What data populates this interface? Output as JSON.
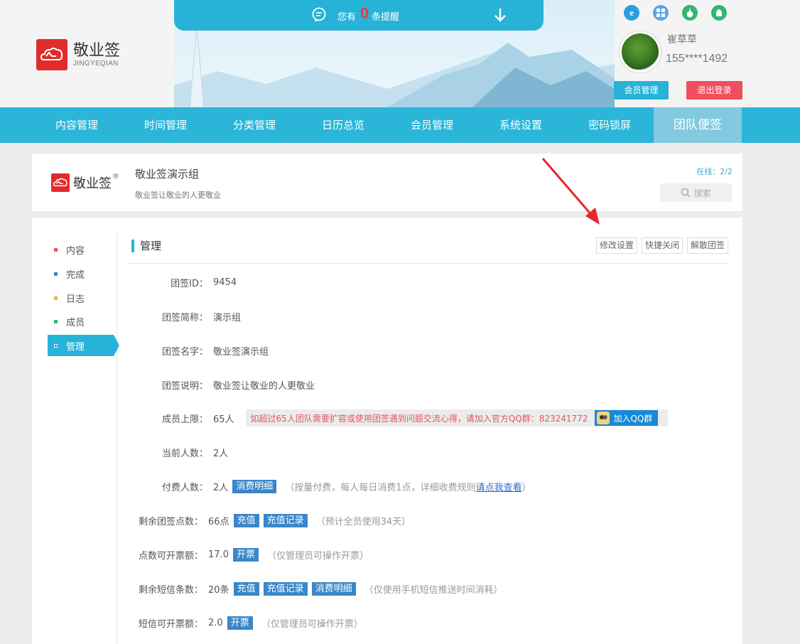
{
  "notice": {
    "prefix": "您有",
    "count": "0",
    "suffix": "条提醒"
  },
  "brand": {
    "name_cn": "敬业签",
    "name_en": "JINGYEQIAN"
  },
  "user": {
    "name": "崔草草",
    "phone": "155****1492",
    "member_label": "会员管理",
    "logout_label": "退出登录"
  },
  "os_icons": [
    "ie-icon",
    "windows-icon",
    "apple-icon",
    "android-icon"
  ],
  "nav": [
    "内容管理",
    "时间管理",
    "分类管理",
    "日历总览",
    "会员管理",
    "系统设置",
    "密码锁屏",
    "团队便签"
  ],
  "group": {
    "logo_text": "敬业签",
    "reg_mark": "®",
    "name": "敬业签演示组",
    "desc": "敬业签让敬业的人更敬业",
    "online": "在线：2/2",
    "search_placeholder": "搜索"
  },
  "sidebar": [
    {
      "label": "内容",
      "color": "#e0585a"
    },
    {
      "label": "完成",
      "color": "#3a86c8"
    },
    {
      "label": "日志",
      "color": "#f0b43c"
    },
    {
      "label": "成员",
      "color": "#2eb872"
    },
    {
      "label": "管理",
      "color": "#3a86c8"
    }
  ],
  "section": {
    "title": "管理",
    "actions": [
      "修改设置",
      "快捷关闭",
      "解散团签"
    ]
  },
  "fields": {
    "id": {
      "label": "团签ID：",
      "value": "9454"
    },
    "short_name": {
      "label": "团签简称：",
      "value": "演示组"
    },
    "full_name": {
      "label": "团签名字：",
      "value": "敬业签演示组"
    },
    "description": {
      "label": "团签说明：",
      "value": "敬业签让敬业的人更敬业"
    },
    "member_limit": {
      "label": "成员上限：",
      "value": "65人",
      "warning": "如超过65人团队需要扩容或使用团签遇到问题交流心得，请加入官方QQ群：823241772",
      "qq_button": "加入QQ群"
    },
    "current_count": {
      "label": "当前人数：",
      "value": "2人"
    },
    "paid_count": {
      "label": "付费人数：",
      "value": "2人",
      "tag": "消费明细",
      "note_prefix": "（按量付费，每人每日消费1点，详细收费规则",
      "note_link": "请点我查看",
      "note_suffix": "）"
    },
    "points_left": {
      "label": "剩余团签点数：",
      "value": "66点",
      "tags": [
        "充值",
        "充值记录"
      ],
      "note": "（预计全员使用34天）"
    },
    "points_invoice": {
      "label": "点数可开票额：",
      "value": "17.0",
      "tag": "开票",
      "note": "（仅管理员可操作开票）"
    },
    "sms_left": {
      "label": "剩余短信条数：",
      "value": "20条",
      "tags": [
        "充值",
        "充值记录",
        "消费明细"
      ],
      "note": "（仅使用手机短信推送时间消耗）"
    },
    "sms_invoice": {
      "label": "短信可开票额：",
      "value": "2.0",
      "tag": "开票",
      "note": "（仅管理员可操作开票）"
    }
  }
}
